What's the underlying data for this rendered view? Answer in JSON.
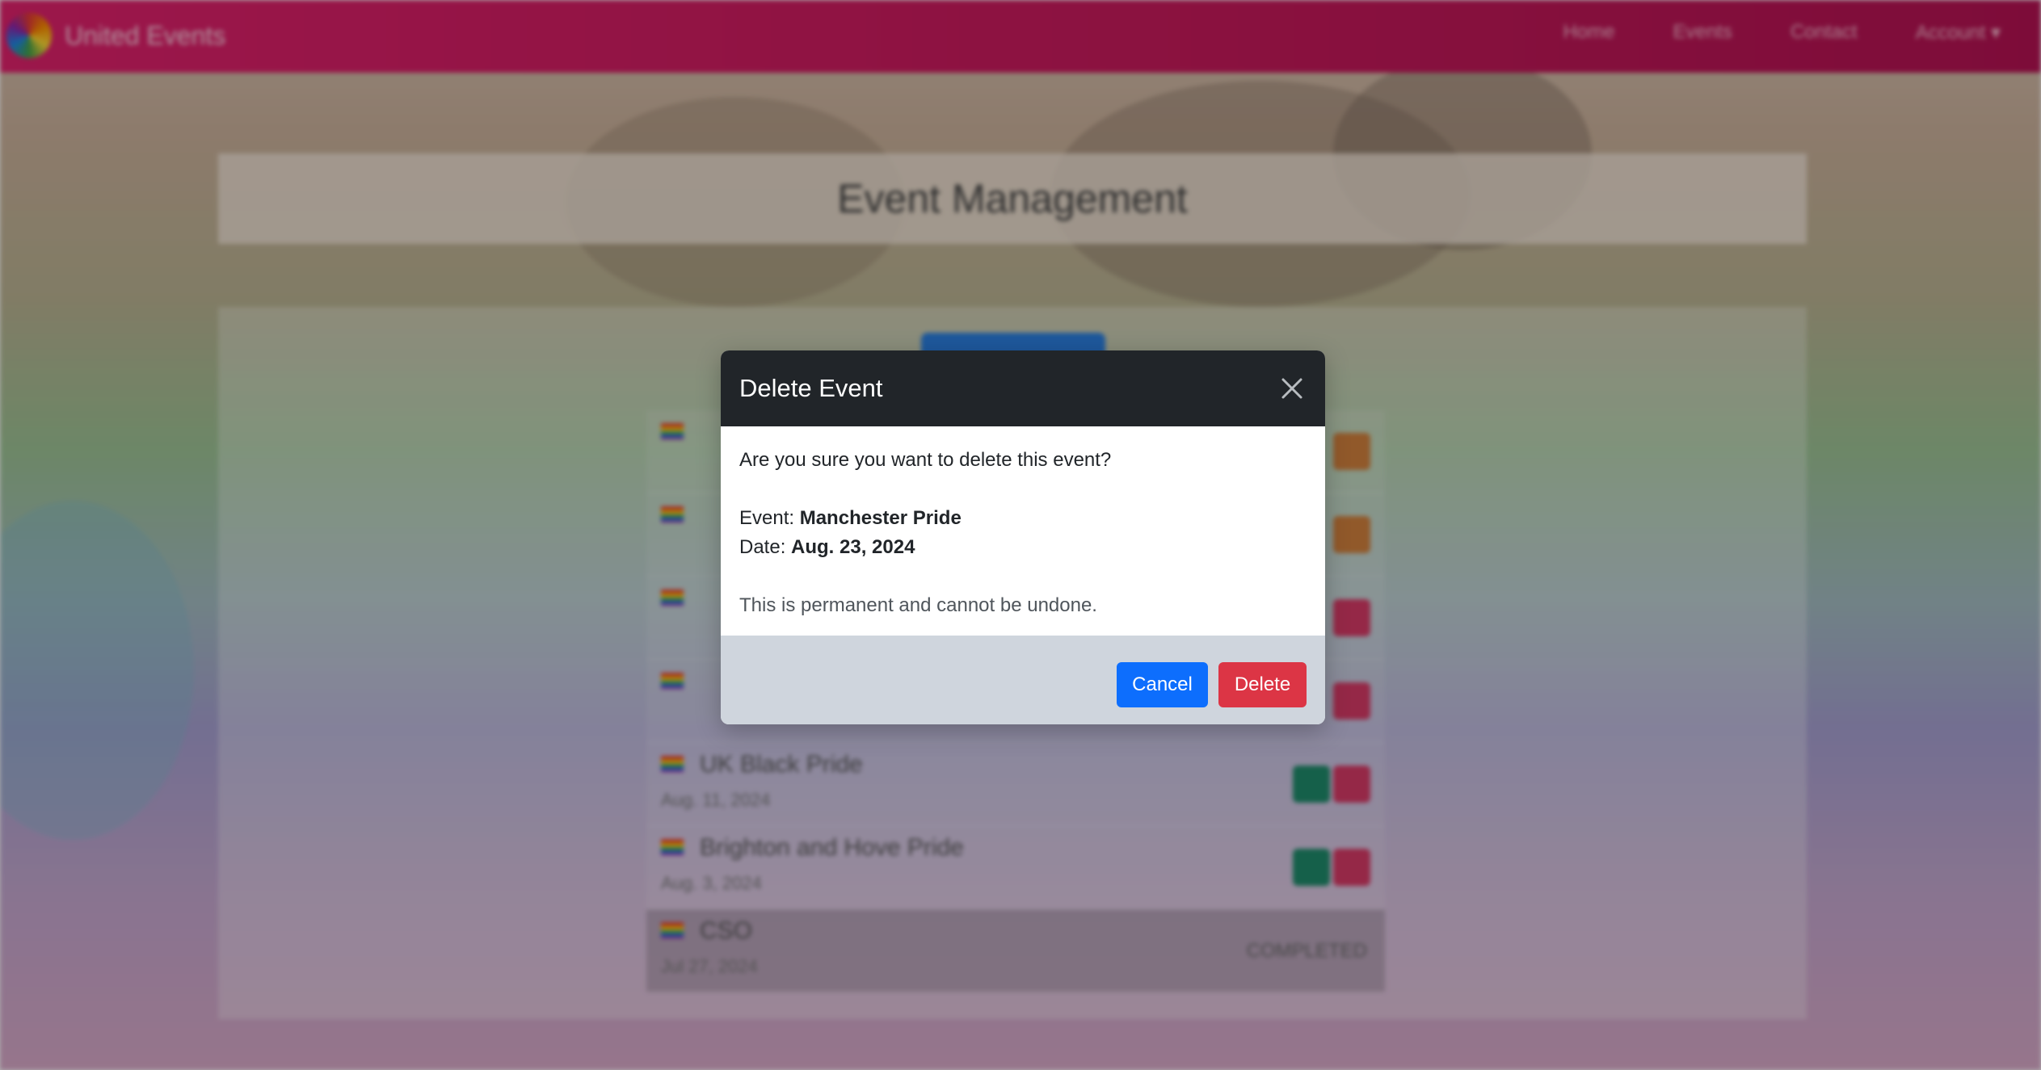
{
  "navbar": {
    "brand": "United Events",
    "links": [
      "Home",
      "Events",
      "Contact",
      "Account"
    ]
  },
  "page": {
    "title": "Event Management"
  },
  "events": [
    {
      "name": "",
      "date": "",
      "status": "actions-orange"
    },
    {
      "name": "",
      "date": "",
      "status": "actions-orange"
    },
    {
      "name": "",
      "date": "",
      "status": "actions"
    },
    {
      "name": "",
      "date": "",
      "status": "actions"
    },
    {
      "name": "UK Black Pride",
      "date": "Aug. 11, 2024",
      "status": "actions"
    },
    {
      "name": "Brighton and Hove Pride",
      "date": "Aug. 3, 2024",
      "status": "actions"
    },
    {
      "name": "CSO",
      "date": "Jul 27, 2024",
      "status": "COMPLETED"
    }
  ],
  "modal": {
    "title": "Delete Event",
    "question": "Are you sure you want to delete this event?",
    "event_label": "Event: ",
    "event_value": "Manchester Pride",
    "date_label": "Date: ",
    "date_value": "Aug. 23, 2024",
    "warning": "This is permanent and cannot be undone.",
    "cancel_label": "Cancel",
    "delete_label": "Delete"
  },
  "colors": {
    "navbar": "#c81a5c",
    "modal_header": "#212529",
    "modal_footer": "#cfd5dd",
    "cancel_button": "#0d6efd",
    "delete_button": "#dc3545"
  },
  "icons": {
    "close": "close-icon"
  }
}
